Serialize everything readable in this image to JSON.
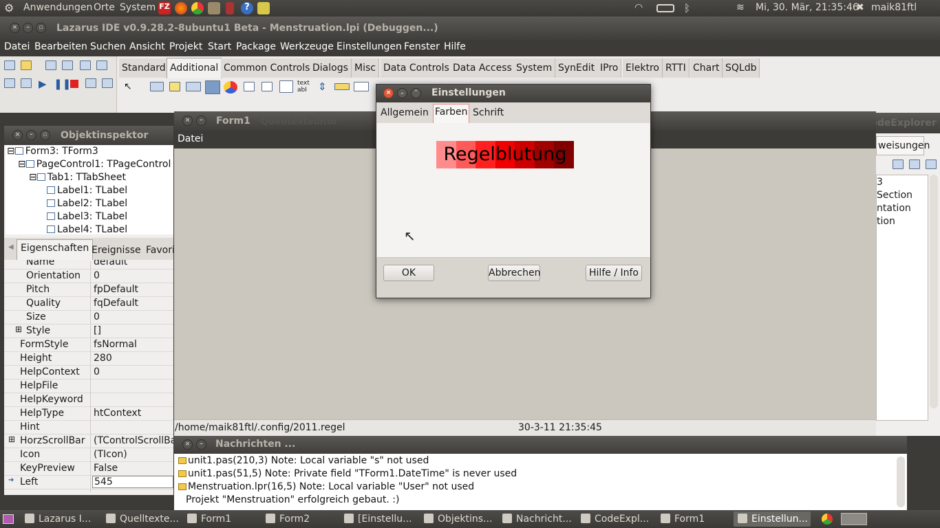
{
  "top_panel": {
    "menus": [
      "Anwendungen",
      "Orte",
      "System"
    ],
    "clock": "Mi, 30. Mär, 21:35:46",
    "user": "maik81ftl"
  },
  "ide": {
    "title": "Lazarus IDE v0.9.28.2-8ubuntu1 Beta - Menstruation.lpi (Debuggen...)",
    "menu": [
      "Datei",
      "Bearbeiten",
      "Suchen",
      "Ansicht",
      "Projekt",
      "Start",
      "Package",
      "Werkzeuge",
      "Einstellungen",
      "Fenster",
      "Hilfe"
    ],
    "palette_tabs": [
      "Standard",
      "Additional",
      "Common Controls",
      "Dialogs",
      "Misc",
      "Data Controls",
      "Data Access",
      "System",
      "SynEdit",
      "IPro",
      "Elektro",
      "RTTI",
      "Chart",
      "SQLdb"
    ],
    "active_palette_tab": "Additional"
  },
  "object_inspector": {
    "title": "Objektinspektor",
    "tree": [
      "Form3: TForm3",
      "PageControl1: TPageControl",
      "Tab1: TTabSheet",
      "Label1: TLabel",
      "Label2: TLabel",
      "Label3: TLabel",
      "Label4: TLabel"
    ],
    "tabs": [
      "Eigenschaften",
      "Ereignisse",
      "Favori"
    ],
    "properties": [
      {
        "name": "Name",
        "value": "default"
      },
      {
        "name": "Orientation",
        "value": "0"
      },
      {
        "name": "Pitch",
        "value": "fpDefault"
      },
      {
        "name": "Quality",
        "value": "fqDefault"
      },
      {
        "name": "Size",
        "value": "0"
      },
      {
        "name": "Style",
        "value": "[]"
      },
      {
        "name": "FormStyle",
        "value": "fsNormal"
      },
      {
        "name": "Height",
        "value": "280"
      },
      {
        "name": "HelpContext",
        "value": "0"
      },
      {
        "name": "HelpFile",
        "value": ""
      },
      {
        "name": "HelpKeyword",
        "value": ""
      },
      {
        "name": "HelpType",
        "value": "htContext"
      },
      {
        "name": "Hint",
        "value": ""
      },
      {
        "name": "HorzScrollBar",
        "value": "(TControlScrollBar)"
      },
      {
        "name": "Icon",
        "value": "(TIcon)"
      },
      {
        "name": "KeyPreview",
        "value": "False"
      },
      {
        "name": "Left",
        "value": "545"
      }
    ]
  },
  "form1": {
    "title": "Form1",
    "menu": "Datei",
    "status_path": "/home/maik81ftl/.config/2011.regel",
    "status_time": "30-3-11 21:35:45"
  },
  "background_titles": {
    "source_editor": "Quelltexteditor",
    "code_explorer": "CodeExplorer",
    "code_tab": "weisungen",
    "code_lines": [
      "3",
      "Section",
      "ntation",
      "tion"
    ]
  },
  "messages": {
    "title": "Nachrichten ...",
    "lines": [
      "unit1.pas(210,3) Note: Local variable \"s\" not used",
      "unit1.pas(51,5) Note: Private field \"TForm1.DateTime\" is never used",
      "Menstruation.lpr(16,5) Note: Local variable \"User\" not used",
      "Projekt \"Menstruation\" erfolgreich gebaut. :)"
    ]
  },
  "dialog": {
    "title": "Einstellungen",
    "tabs": [
      "Allgemein",
      "Farben",
      "Schrift"
    ],
    "active_tab": "Farben",
    "preview_text": "Regelblutung",
    "gradient_colors": [
      "#ff8c8c",
      "#ff5a5a",
      "#ff2020",
      "#f00000",
      "#cc0000",
      "#a00000",
      "#800000"
    ],
    "buttons": {
      "ok": "OK",
      "cancel": "Abbrechen",
      "help": "Hilfe / Info"
    }
  },
  "taskbar": [
    {
      "label": "Lazarus I...",
      "active": false
    },
    {
      "label": "Quelltexte...",
      "active": false
    },
    {
      "label": "Form1",
      "active": false
    },
    {
      "label": "Form2",
      "active": false
    },
    {
      "label": "[Einstellu...",
      "active": false
    },
    {
      "label": "Objektins...",
      "active": false
    },
    {
      "label": "Nachricht...",
      "active": false
    },
    {
      "label": "CodeExpl...",
      "active": false
    },
    {
      "label": "Form1",
      "active": false
    },
    {
      "label": "Einstellun...",
      "active": true
    }
  ]
}
